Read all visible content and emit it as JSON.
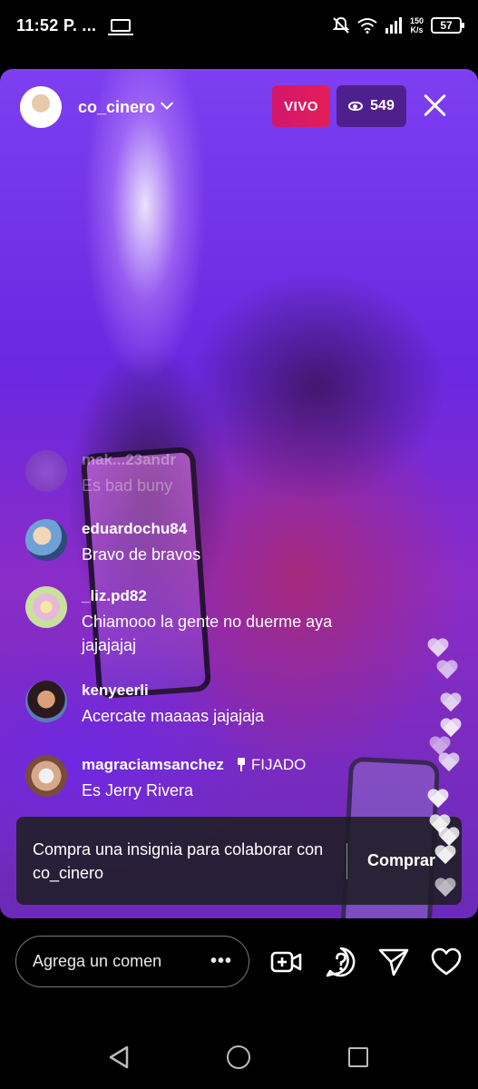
{
  "status_bar": {
    "time": "11:52 P. ...",
    "speed_top": "150",
    "speed_bottom": "K/s",
    "battery": "57"
  },
  "live": {
    "host": "co_cinero",
    "badge": "VIVO",
    "viewers": "549"
  },
  "comments": [
    {
      "user": "mak...23andr",
      "text": "Es bad buny"
    },
    {
      "user": "eduardochu84",
      "text": "Bravo de bravos"
    },
    {
      "user": "_liz.pd82",
      "text": "Chiamooo la gente no duerme aya jajajajaj"
    },
    {
      "user": "kenyeerli",
      "text": "Acercate maaaas jajajaja"
    },
    {
      "user": "magraciamsanchez",
      "pinned_label": "FIJADO",
      "text": "Es Jerry Rivera"
    }
  ],
  "banner": {
    "text": "Compra una insignia para colaborar con co_cinero",
    "button": "Comprar"
  },
  "bottom_bar": {
    "comment_placeholder": "Agrega un comen",
    "more": "•••"
  },
  "icons": {
    "add_video": "add-video-icon",
    "question": "question-icon",
    "send": "send-icon",
    "like": "heart-icon"
  }
}
